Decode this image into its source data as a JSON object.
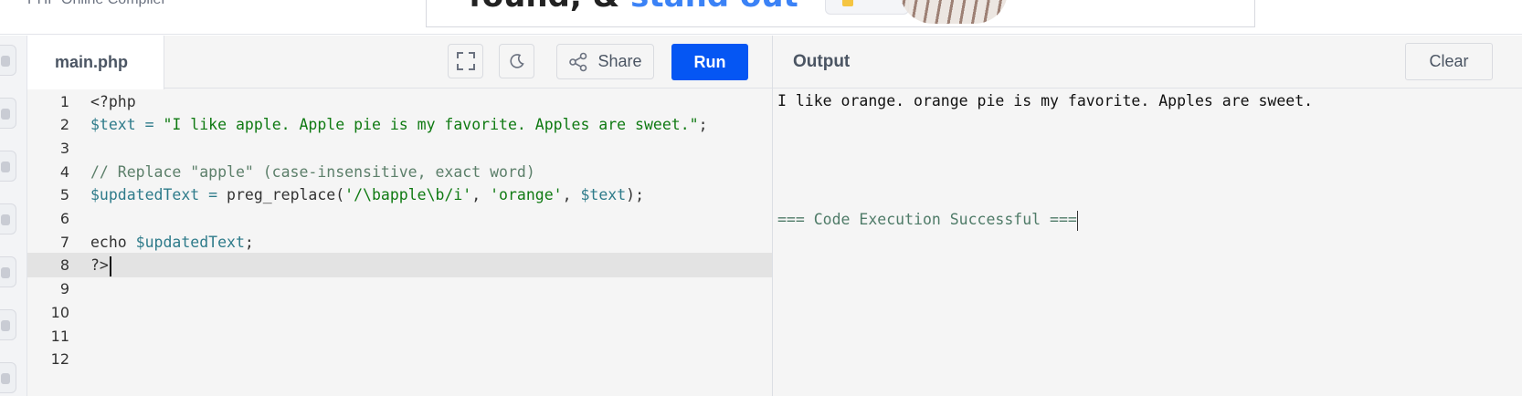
{
  "app": {
    "title": "PHP Online Compiler"
  },
  "ad": {
    "text_main": "found, & ",
    "text_highlight": "stand out"
  },
  "editor": {
    "file_tab": "main.php",
    "share_label": "Share",
    "run_label": "Run",
    "active_line": 8,
    "lines": [
      {
        "num": "1",
        "segments": [
          {
            "t": "kw",
            "v": "<?php"
          }
        ]
      },
      {
        "num": "2",
        "segments": [
          {
            "t": "var",
            "v": "$text"
          },
          {
            "t": "kw",
            "v": " "
          },
          {
            "t": "var",
            "v": "="
          },
          {
            "t": "kw",
            "v": " "
          },
          {
            "t": "str",
            "v": "\"I like apple. Apple pie is my favorite. Apples are sweet.\""
          },
          {
            "t": "kw",
            "v": ";"
          }
        ]
      },
      {
        "num": "3",
        "segments": []
      },
      {
        "num": "4",
        "segments": [
          {
            "t": "com",
            "v": "// Replace \"apple\" (case-insensitive, exact word)"
          }
        ]
      },
      {
        "num": "5",
        "segments": [
          {
            "t": "var",
            "v": "$updatedText"
          },
          {
            "t": "kw",
            "v": " "
          },
          {
            "t": "var",
            "v": "="
          },
          {
            "t": "kw",
            "v": " preg_replace("
          },
          {
            "t": "str",
            "v": "'/\\bapple\\b/i'"
          },
          {
            "t": "kw",
            "v": ", "
          },
          {
            "t": "str",
            "v": "'orange'"
          },
          {
            "t": "kw",
            "v": ", "
          },
          {
            "t": "var",
            "v": "$text"
          },
          {
            "t": "kw",
            "v": ");"
          }
        ]
      },
      {
        "num": "6",
        "segments": []
      },
      {
        "num": "7",
        "segments": [
          {
            "t": "kw",
            "v": "echo "
          },
          {
            "t": "var",
            "v": "$updatedText"
          },
          {
            "t": "kw",
            "v": ";"
          }
        ]
      },
      {
        "num": "8",
        "segments": [
          {
            "t": "kw",
            "v": "?>"
          }
        ]
      },
      {
        "num": "9",
        "segments": []
      },
      {
        "num": "10",
        "segments": []
      },
      {
        "num": "11",
        "segments": []
      },
      {
        "num": "12",
        "segments": []
      }
    ]
  },
  "output": {
    "title": "Output",
    "clear_label": "Clear",
    "result": "I like orange. orange pie is my favorite. Apples are sweet.",
    "status": "=== Code Execution Successful ==="
  },
  "icons": {
    "fullscreen": "fullscreen-icon",
    "theme": "moon-icon",
    "share": "share-icon"
  },
  "colors": {
    "run_button": "#0556f3",
    "string": "#0f7a12",
    "variable": "#2e7b8a",
    "comment": "#5c7f6a",
    "status": "#4f7b68"
  }
}
